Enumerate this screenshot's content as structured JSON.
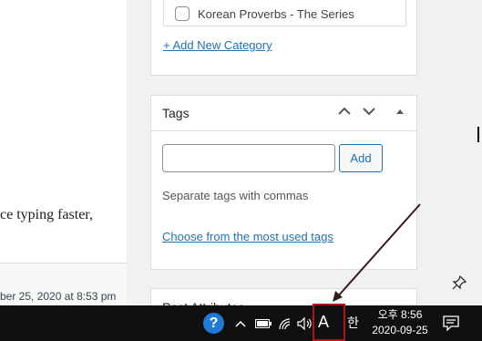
{
  "editor": {
    "body_text_fragment": "ce typing faster,",
    "last_edited": "ber 25, 2020 at 8:53 pm"
  },
  "categories": {
    "items": [
      {
        "label": "Korean Proverbs - The Series",
        "checked": false
      }
    ],
    "add_link": "+ Add New Category"
  },
  "tags": {
    "title": "Tags",
    "input_value": "",
    "add_button": "Add",
    "help": "Separate tags with commas",
    "most_used_link": "Choose from the most used tags",
    "controls": [
      "chevron-up-icon",
      "chevron-down-icon",
      "triangle-up-icon"
    ]
  },
  "attributes": {
    "title": "Post Attributes"
  },
  "taskbar": {
    "help_glyph": "?",
    "ime_mode": "A",
    "han_key": "한",
    "time": "오후 8:56",
    "date": "2020-09-25"
  },
  "colors": {
    "link": "#2271b1",
    "taskbar": "#101010",
    "highlight_box": "#b01414",
    "help_icon": "#1f7ad8"
  }
}
